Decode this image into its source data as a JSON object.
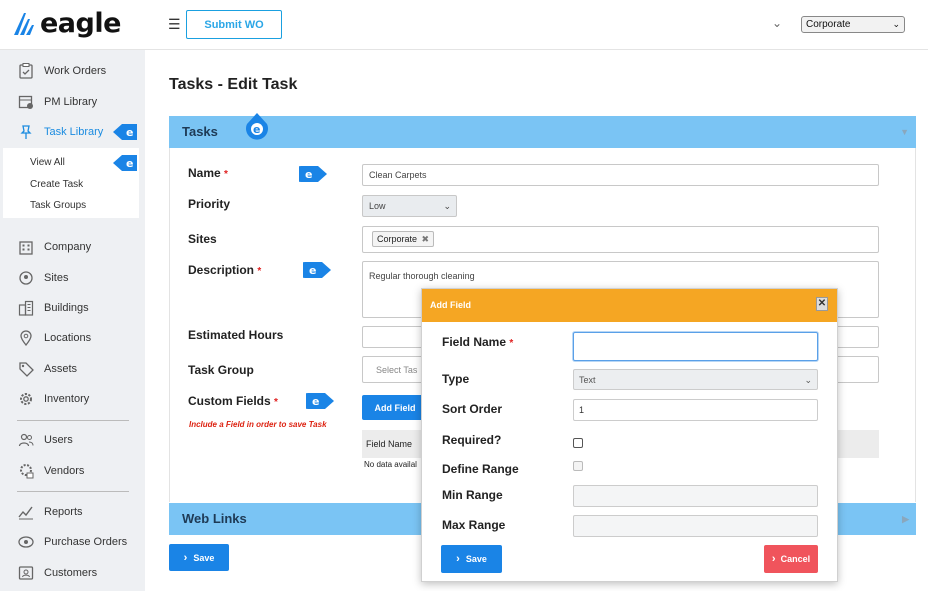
{
  "header": {
    "logo_text": "eagle",
    "submit_wo": "Submit WO",
    "site_select": "Corporate"
  },
  "sidebar": {
    "items": [
      {
        "label": "Work Orders",
        "icon": "clipboard-check-icon"
      },
      {
        "label": "PM Library",
        "icon": "calendar-clock-icon"
      },
      {
        "label": "Task Library",
        "icon": "pushpin-icon"
      },
      {
        "label": "Company",
        "icon": "building-icon"
      },
      {
        "label": "Sites",
        "icon": "map-pin-icon"
      },
      {
        "label": "Buildings",
        "icon": "buildings-icon"
      },
      {
        "label": "Locations",
        "icon": "location-icon"
      },
      {
        "label": "Assets",
        "icon": "tag-icon"
      },
      {
        "label": "Inventory",
        "icon": "gear-icon"
      },
      {
        "label": "Users",
        "icon": "users-icon"
      },
      {
        "label": "Vendors",
        "icon": "vendor-icon"
      },
      {
        "label": "Reports",
        "icon": "chart-line-icon"
      },
      {
        "label": "Purchase Orders",
        "icon": "dollar-icon"
      },
      {
        "label": "Customers",
        "icon": "customer-card-icon"
      }
    ],
    "sub_items": [
      "View All",
      "Create Task",
      "Task Groups"
    ]
  },
  "main": {
    "title": "Tasks - Edit Task",
    "tasks_panel": "Tasks",
    "web_links_panel": "Web Links",
    "labels": {
      "name": "Name",
      "priority": "Priority",
      "sites": "Sites",
      "description": "Description",
      "estimated_hours": "Estimated Hours",
      "task_group": "Task Group",
      "custom_fields": "Custom Fields"
    },
    "name_value": "Clean Carpets",
    "priority_value": "Low",
    "site_tag": "Corporate",
    "description_value": "Regular thorough cleaning",
    "task_group_placeholder": "Select Tas",
    "custom_fields_hint": "Include a Field in order to save Task",
    "add_field_button": "Add Field",
    "grid_header": "Field Name",
    "grid_empty": "No data availal",
    "save_button": "Save"
  },
  "modal": {
    "title": "Add Field",
    "labels": {
      "field_name": "Field Name",
      "type": "Type",
      "sort_order": "Sort Order",
      "required": "Required?",
      "define_range": "Define Range",
      "min_range": "Min Range",
      "max_range": "Max Range"
    },
    "type_value": "Text",
    "sort_order_value": "1",
    "save_button": "Save",
    "cancel_button": "Cancel"
  },
  "colors": {
    "brand_blue": "#1a84e6",
    "panel_header": "#7ac4f4",
    "modal_header": "#f5a623",
    "cancel": "#f0545c",
    "required": "#e02020"
  }
}
